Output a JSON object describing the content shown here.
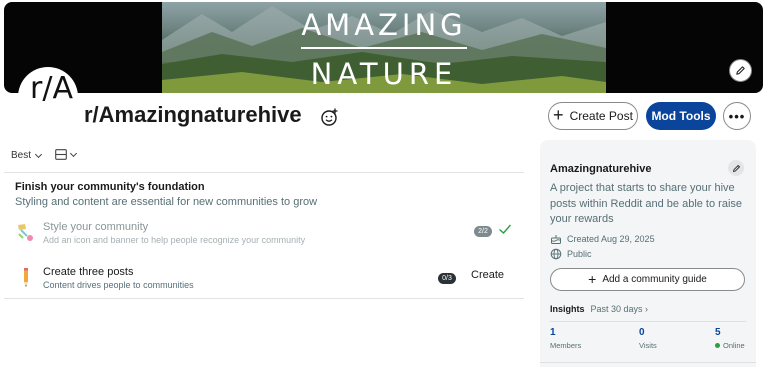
{
  "banner": {
    "title_line_1": "AMAZING",
    "title_line_2": "NATURE",
    "edit_icon": "pencil-icon"
  },
  "avatar": {
    "text": "r/A"
  },
  "community": {
    "name": "r/Amazingnaturehive",
    "emoji_icon": "add-emoji-icon"
  },
  "header_actions": {
    "create_post": "Create Post",
    "mod_tools": "Mod Tools",
    "more_icon": "ellipsis-icon",
    "more_label": "•••"
  },
  "feed_controls": {
    "sort": "Best",
    "view_icon": "card-view-icon"
  },
  "foundation": {
    "title": "Finish your community's foundation",
    "subtitle": "Styling and content are essential for new communities to grow",
    "tasks": [
      {
        "title": "Style your community",
        "description": "Add an icon and banner to help people recognize your community",
        "progress": "2/2",
        "status": "complete",
        "icon": "paint-icon"
      },
      {
        "title": "Create three posts",
        "description": "Content drives people to communities",
        "progress": "0/3",
        "action": "Create",
        "icon": "pencil-icon"
      }
    ]
  },
  "sidebar": {
    "name": "Amazingnaturehive",
    "description": "A project that starts to share your hive posts within Reddit and be able to raise your rewards",
    "created": "Created Aug 29, 2025",
    "visibility": "Public",
    "guide_button": "Add a community guide",
    "insights_label": "Insights",
    "insights_period": "Past 30 days",
    "stats": [
      {
        "value": "1",
        "label": "Members"
      },
      {
        "value": "0",
        "label": "Visits"
      },
      {
        "value": "5",
        "label": "Online"
      }
    ]
  },
  "colors": {
    "accent": "#0a449b",
    "online": "#2e9e3e",
    "sidebar_bg": "#f3f5f6"
  }
}
